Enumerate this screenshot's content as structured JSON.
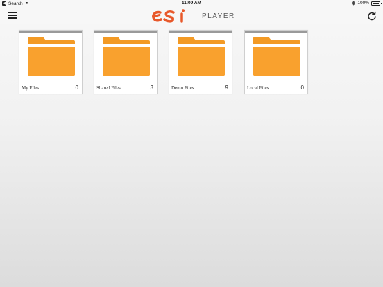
{
  "status_bar": {
    "back_app": "Search",
    "time": "11:09 AM",
    "battery": "100%",
    "battery_level": 1.0
  },
  "header": {
    "logo_text": "esi",
    "product_name": "PLAYER",
    "brand_color": "#e8582a"
  },
  "folders": [
    {
      "label": "My Files",
      "count": "0"
    },
    {
      "label": "Shared Files",
      "count": "3"
    },
    {
      "label": "Demo Files",
      "count": "9"
    },
    {
      "label": "Local Files",
      "count": "0"
    }
  ],
  "colors": {
    "folder": "#f9a12e",
    "folder_tab": "#f39a25",
    "folder_paper": "#ffffff"
  },
  "icons": {
    "menu": "hamburger-menu-icon",
    "refresh": "refresh-icon",
    "folder": "folder-icon",
    "bluetooth": "bluetooth-icon",
    "battery": "battery-icon"
  }
}
